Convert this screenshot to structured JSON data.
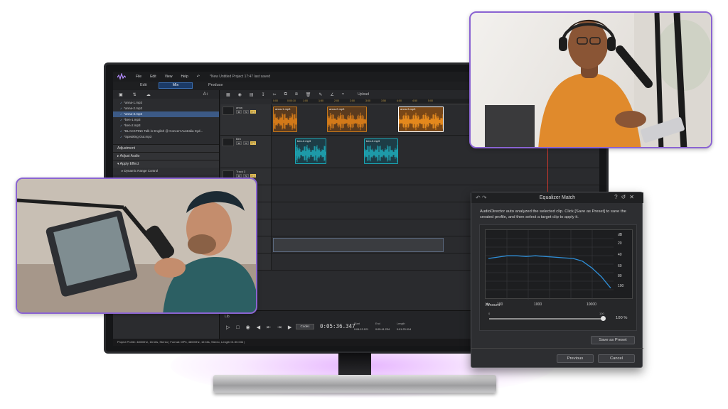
{
  "app": {
    "menu": [
      "File",
      "Edit",
      "View",
      "Help"
    ],
    "project_title": "*New Untitled Project 17:47 last saved",
    "modes": {
      "edit": "Edit",
      "mix": "Mix",
      "produce": "Produce"
    }
  },
  "library": {
    "files": [
      "*anna-1.mp3",
      "*anna-2.mp3",
      "*anna-3.mp3",
      "*ben-1.mp3",
      "*ben-2.mp3",
      "*BLACKPINK Talk in English @ Concert Australia Syd...",
      "*Speaking Out.mp3"
    ],
    "selected_index": 2,
    "adjustment_header": "Adjustment",
    "adjust_audio": "Adjust Audio",
    "apply_effect": "Apply Effect",
    "effect_item": "Dynamic Range Control"
  },
  "timeline": {
    "toolbar_upload": "Upload",
    "ruler_ticks": [
      "0:00",
      "0:00:10",
      "1:00",
      "1:50",
      "2:00",
      "2:50",
      "3:00",
      "3:50",
      "4:00",
      "4:50",
      "5:00"
    ],
    "tracks": [
      {
        "name": "anna",
        "clips": [
          "anna-1.mp3",
          "anna-2.mp3",
          "anna-3.mp3"
        ]
      },
      {
        "name": "Ben",
        "clips": [
          "ben-2.mp3",
          "ben-2.mp3"
        ]
      },
      {
        "name": "Track 3",
        "clips": []
      }
    ],
    "track_btn_m": "M",
    "track_btn_s": "S",
    "track_btn_lr": "LR"
  },
  "transport": {
    "library_label": "Lib",
    "codec": "Codec",
    "timecode": "0:05:36.347",
    "start_label": "Start",
    "start_value": "0:04:13.121",
    "end_label": "End",
    "end_value": "0:05:41.234",
    "length_label": "Length",
    "length_value": "0:01:23.014"
  },
  "status": {
    "profile": "Project Profile: 48000Hz, 16 bits, Stereo | Format: MP3, 48000Hz, 16 bits, Stereo, Length 01:30.034 |"
  },
  "equalizer": {
    "title": "Equalizer Match",
    "message": "AudioDirector auto analyzed the selected clip. Click [Save as Preset] to save the created profile, and then select a target clip to apply it.",
    "y_unit": "dB",
    "y_ticks": [
      "20",
      "40",
      "60",
      "80",
      "100"
    ],
    "x_unit": "Hz",
    "x_ticks": [
      "100",
      "1000",
      "10000"
    ],
    "amount_label": "Amount",
    "amount_value": "100 %",
    "amount_min": "0",
    "amount_max": "100",
    "amount_fraction": 1.0,
    "save_preset": "Save as Preset",
    "previous": "Previous",
    "cancel": "Cancel",
    "curve_db": [
      48,
      46,
      44,
      44,
      45,
      44,
      45,
      46,
      47,
      48,
      52,
      62,
      75,
      92
    ],
    "accent_color": "#2f8fd8"
  },
  "colors": {
    "card_border": "#8a63d2",
    "clip_orange": "#f08a18",
    "clip_teal": "#1fb3c2",
    "mode_active": "#1b3a66"
  }
}
